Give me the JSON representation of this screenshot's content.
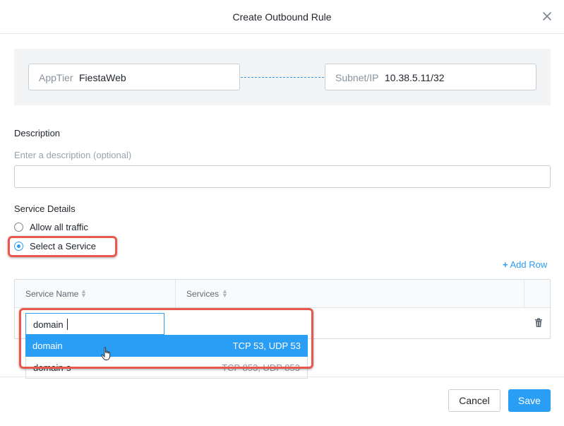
{
  "dialog": {
    "title": "Create Outbound Rule",
    "close_icon": "close-icon"
  },
  "rule": {
    "source_label": "AppTier",
    "source_value": "FiestaWeb",
    "dest_label": "Subnet/IP",
    "dest_value": "10.38.5.11/32"
  },
  "description": {
    "title": "Description",
    "placeholder": "Enter a description (optional)",
    "value": ""
  },
  "service_details": {
    "title": "Service Details",
    "options": [
      {
        "label": "Allow all traffic",
        "selected": false
      },
      {
        "label": "Select a Service",
        "selected": true
      }
    ],
    "add_row_icon": "+",
    "add_row_label": "Add Row"
  },
  "table": {
    "columns": [
      "Service Name",
      "Services"
    ],
    "sort_icon": "sort-icon"
  },
  "dropdown": {
    "input_value": "domain",
    "options": [
      {
        "name": "domain",
        "services": "TCP 53, UDP 53",
        "highlighted": true
      },
      {
        "name": "domain-s",
        "services": "TCP 853, UDP 853",
        "highlighted": false
      }
    ]
  },
  "footer": {
    "cancel_label": "Cancel",
    "save_label": "Save"
  },
  "colors": {
    "accent": "#2a9df4",
    "highlight_border": "#e8584e"
  }
}
